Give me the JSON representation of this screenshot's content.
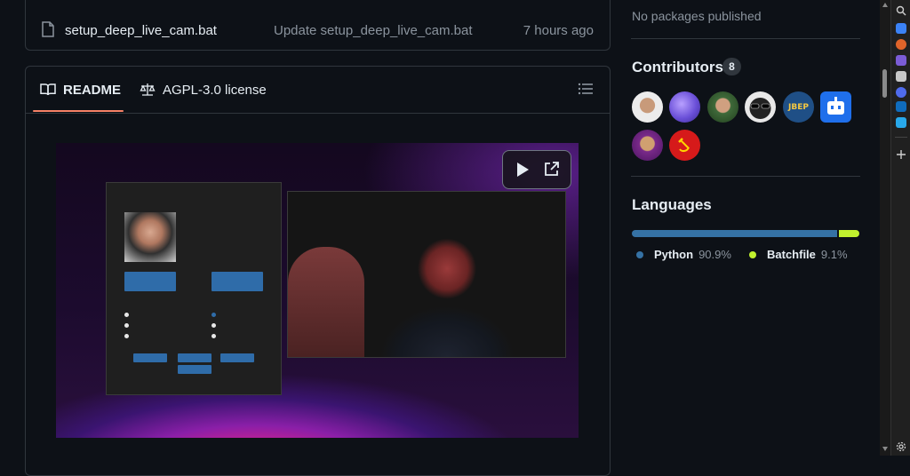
{
  "file_row": {
    "name": "setup_deep_live_cam.bat",
    "commit_message": "Update setup_deep_live_cam.bat",
    "age": "7 hours ago"
  },
  "readme": {
    "tabs": [
      {
        "label": "README",
        "icon": "book-icon",
        "active": true
      },
      {
        "label": "AGPL-3.0 license",
        "icon": "scale-icon",
        "active": false
      }
    ],
    "accent_color": "#f78166"
  },
  "sidebar": {
    "packages_text": "No packages published",
    "contributors": {
      "title": "Contributors",
      "count": "8",
      "jbep_label": "JBEP"
    },
    "languages": {
      "title": "Languages",
      "items": [
        {
          "name": "Python",
          "percent": "90.9%",
          "value": 90.9,
          "color": "#3572A5"
        },
        {
          "name": "Batchfile",
          "percent": "9.1%",
          "value": 9.1,
          "color": "#C1F12E"
        }
      ]
    }
  }
}
